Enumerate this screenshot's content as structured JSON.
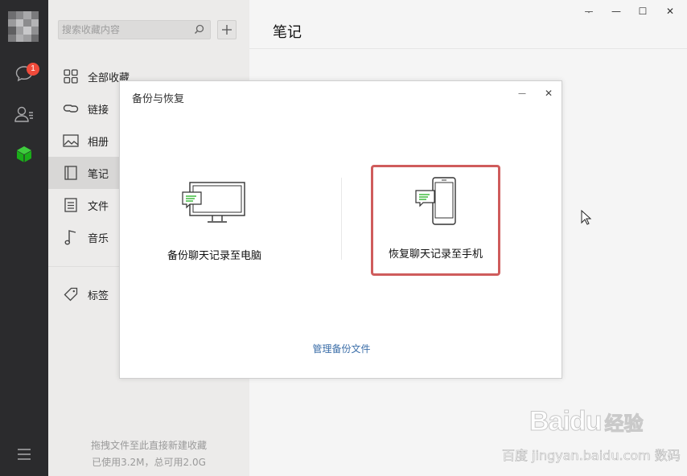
{
  "sidebar_rail": {
    "chat_badge": "1",
    "icons": [
      "chat-icon",
      "contacts-icon",
      "favorites-cube-icon",
      "menu-icon"
    ],
    "accent_color": "#1aad19"
  },
  "panel": {
    "search_placeholder": "搜索收藏内容",
    "add_label": "+",
    "items": [
      {
        "label": "全部收藏",
        "icon": "grid-icon"
      },
      {
        "label": "链接",
        "icon": "link-icon"
      },
      {
        "label": "相册",
        "icon": "image-icon"
      },
      {
        "label": "笔记",
        "icon": "note-icon",
        "active": true
      },
      {
        "label": "文件",
        "icon": "file-icon"
      },
      {
        "label": "音乐",
        "icon": "music-icon"
      },
      {
        "label": "标签",
        "icon": "tag-icon"
      }
    ],
    "footer_hint": "拖拽文件至此直接新建收藏",
    "footer_usage": "已使用3.2M，总可用2.0G"
  },
  "main": {
    "title": "笔记",
    "window_controls": {
      "pin": "ᅮ",
      "minimize": "—",
      "maximize": "☐",
      "close": "✕"
    }
  },
  "dialog": {
    "title": "备份与恢复",
    "minimize": "—",
    "close": "✕",
    "backup_label": "备份聊天记录至电脑",
    "restore_label": "恢复聊天记录至手机",
    "manage_link": "管理备份文件",
    "highlight_color": "#cf5c5c"
  },
  "watermark": {
    "logo": "Bai",
    "logo_paw": "du",
    "logo_suffix": "经验",
    "sub": "百度 jingyan.baidu.com 数码"
  }
}
